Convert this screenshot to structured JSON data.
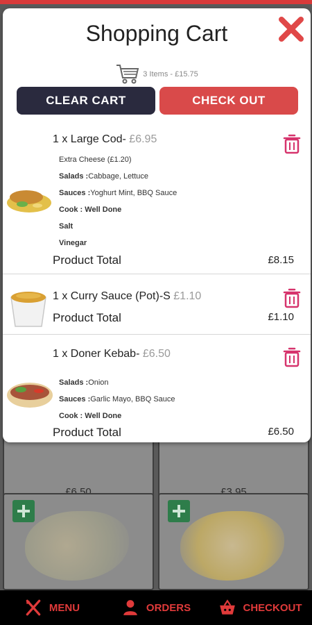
{
  "background": {
    "tiles": [
      {
        "price": "£6.50"
      },
      {
        "price": "£3.95"
      }
    ]
  },
  "bottom_nav": {
    "items": [
      {
        "label": "MENU",
        "icon": "fork-knife-icon"
      },
      {
        "label": "ORDERS",
        "icon": "user-icon"
      },
      {
        "label": "CHECKOUT",
        "icon": "basket-icon"
      }
    ]
  },
  "cart": {
    "title": "Shopping Cart",
    "summary": "3 Items - £15.75",
    "clear_label": "CLEAR CART",
    "checkout_label": "CHECK OUT",
    "items": [
      {
        "title": "1 x Large Cod-",
        "unit_price": "£6.95",
        "options": [
          {
            "label": "",
            "value": "Extra Cheese (£1.20)"
          },
          {
            "label": "Salads :",
            "value": "Cabbage, Lettuce"
          },
          {
            "label": "Sauces :",
            "value": "Yoghurt Mint, BBQ Sauce"
          },
          {
            "label": "Cook : Well Done",
            "value": ""
          },
          {
            "label": "Salt",
            "value": ""
          },
          {
            "label": "Vinegar",
            "value": ""
          }
        ],
        "total_label": "Product Total",
        "total": "£8.15"
      },
      {
        "title": "1 x Curry Sauce (Pot)-S",
        "unit_price": "£1.10",
        "options": [],
        "total_label": "Product Total",
        "total": "£1.10"
      },
      {
        "title": "1 x Doner Kebab-",
        "unit_price": "£6.50",
        "options": [
          {
            "label": "Salads :",
            "value": "Onion"
          },
          {
            "label": "Sauces :",
            "value": "Garlic Mayo, BBQ Sauce"
          },
          {
            "label": "Cook : Well Done",
            "value": ""
          }
        ],
        "total_label": "Product Total",
        "total": "£6.50"
      }
    ]
  },
  "colors": {
    "accent_red": "#d94a4a",
    "dark_button": "#2a2a3e",
    "trash_pink": "#d6336c"
  }
}
